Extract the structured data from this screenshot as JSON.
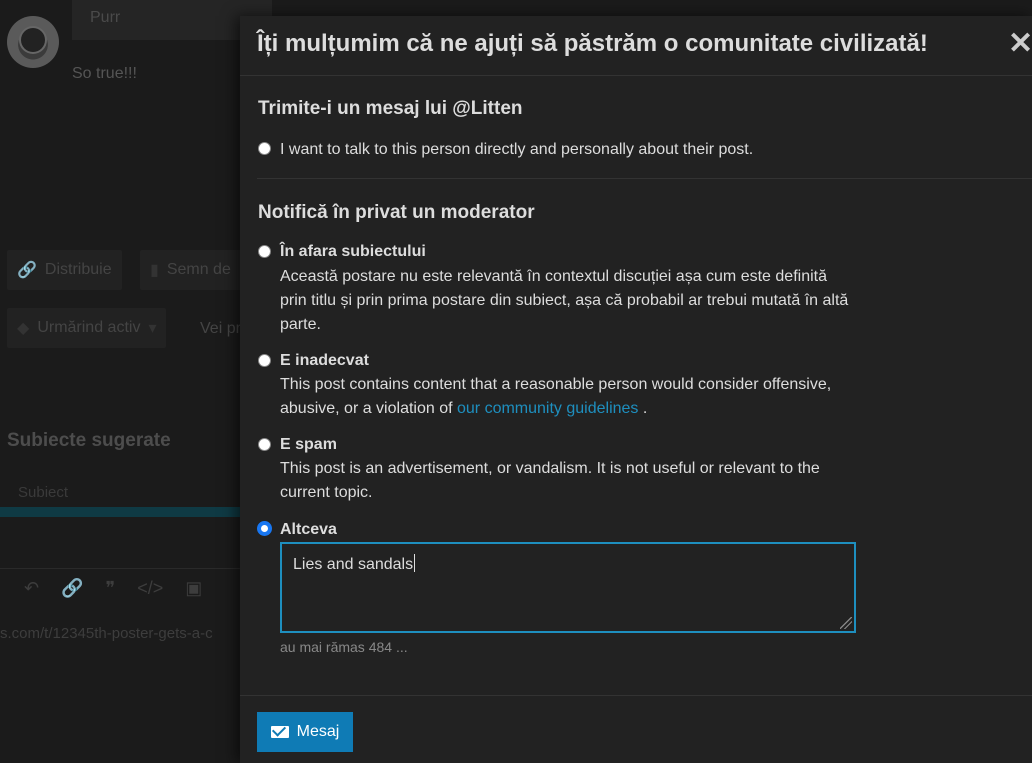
{
  "background": {
    "reply_input_text": "Purr",
    "post_text": "So true!!!",
    "share_label": "Distribuie",
    "bookmark_label": "Semn de",
    "tracking_label": "Urmărind activ",
    "more_label": "Vei pr",
    "suggested_title": "Subiecte sugerate",
    "subject_header": "Subiect",
    "url_text": "s.com/t/12345th-poster-gets-a-c"
  },
  "modal": {
    "title": "Îți mulțumim că ne ajuți să păstrăm o comunitate civilizată!",
    "close_symbol": "✕",
    "message_section_title": "Trimite-i un mesaj lui @Litten",
    "direct_option": "I want to talk to this person directly and personally about their post.",
    "moderator_section_title": "Notifică în privat un moderator",
    "options": [
      {
        "label": "În afara subiectului",
        "desc": "Această postare nu este relevantă în contextul discuției așa cum este definită prin titlu și prin prima postare din subiect, așa că probabil ar trebui mutată în altă parte."
      },
      {
        "label": "E inadecvat",
        "desc_before": "This post contains content that a reasonable person would consider offensive, abusive, or a violation of ",
        "desc_link": "our community guidelines",
        "desc_after": " ."
      },
      {
        "label": "E spam",
        "desc": "This post is an advertisement, or vandalism. It is not useful or relevant to the current topic."
      },
      {
        "label": "Altceva"
      }
    ],
    "textarea_value": "Lies and sandals",
    "counter": "au mai rămas 484 ...",
    "submit_label": "Mesaj",
    "selected_option": "Altceva",
    "accent_color": "#1e8fbf",
    "button_color": "#0f7bb5"
  }
}
